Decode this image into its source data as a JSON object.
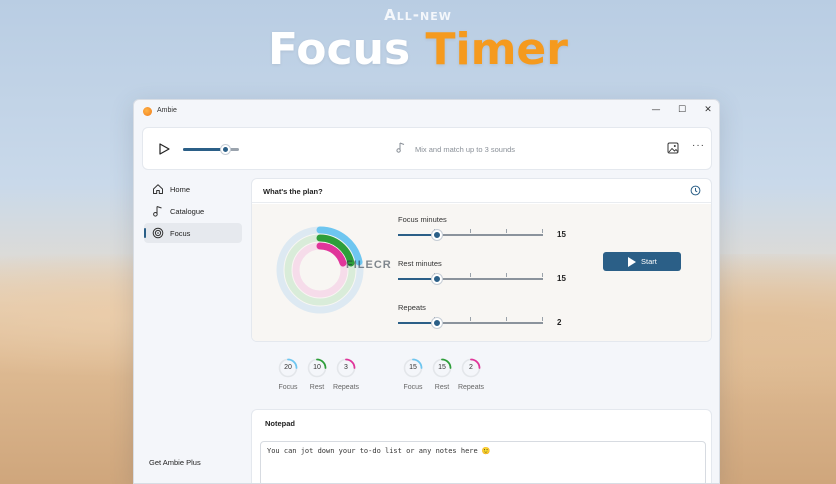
{
  "hero": {
    "kicker": "All-new",
    "title_part1": "Focus",
    "title_part2": "Timer"
  },
  "window": {
    "app_name": "Ambie",
    "controls": {
      "minimize": "—",
      "maximize": "☐",
      "close": "✕"
    }
  },
  "player": {
    "volume_fraction": 0.75,
    "mix_hint": "Mix and match up to 3 sounds",
    "more_label": "···"
  },
  "sidebar": {
    "items": [
      {
        "label": "Home",
        "icon": "home-icon",
        "active": false
      },
      {
        "label": "Catalogue",
        "icon": "music-note-icon",
        "active": false
      },
      {
        "label": "Focus",
        "icon": "target-icon",
        "active": true
      }
    ],
    "footer_link": "Get Ambie Plus"
  },
  "plan": {
    "title": "What's the plan?",
    "sliders": [
      {
        "label": "Focus minutes",
        "value": "15",
        "fraction": 0.27
      },
      {
        "label": "Rest minutes",
        "value": "15",
        "fraction": 0.27
      },
      {
        "label": "Repeats",
        "value": "2",
        "fraction": 0.27
      }
    ],
    "start_label": "Start"
  },
  "watermark": "FILECR",
  "stats_left": [
    {
      "value": "20",
      "label": "Focus",
      "color": "#6ec6f0"
    },
    {
      "value": "10",
      "label": "Rest",
      "color": "#2e9e3a"
    },
    {
      "value": "3",
      "label": "Repeats",
      "color": "#e0359a"
    }
  ],
  "stats_right": [
    {
      "value": "15",
      "label": "Focus",
      "color": "#6ec6f0"
    },
    {
      "value": "15",
      "label": "Rest",
      "color": "#2e9e3a"
    },
    {
      "value": "2",
      "label": "Repeats",
      "color": "#e0359a"
    }
  ],
  "notepad": {
    "title": "Notepad",
    "text": "You can jot down your to-do list or any notes here 🙂"
  },
  "colors": {
    "accent": "#2b5f87",
    "hero_accent": "#f59a1e",
    "ring_focus": "#6ec6f0",
    "ring_rest": "#2e9e3a",
    "ring_repeats": "#e0359a"
  }
}
